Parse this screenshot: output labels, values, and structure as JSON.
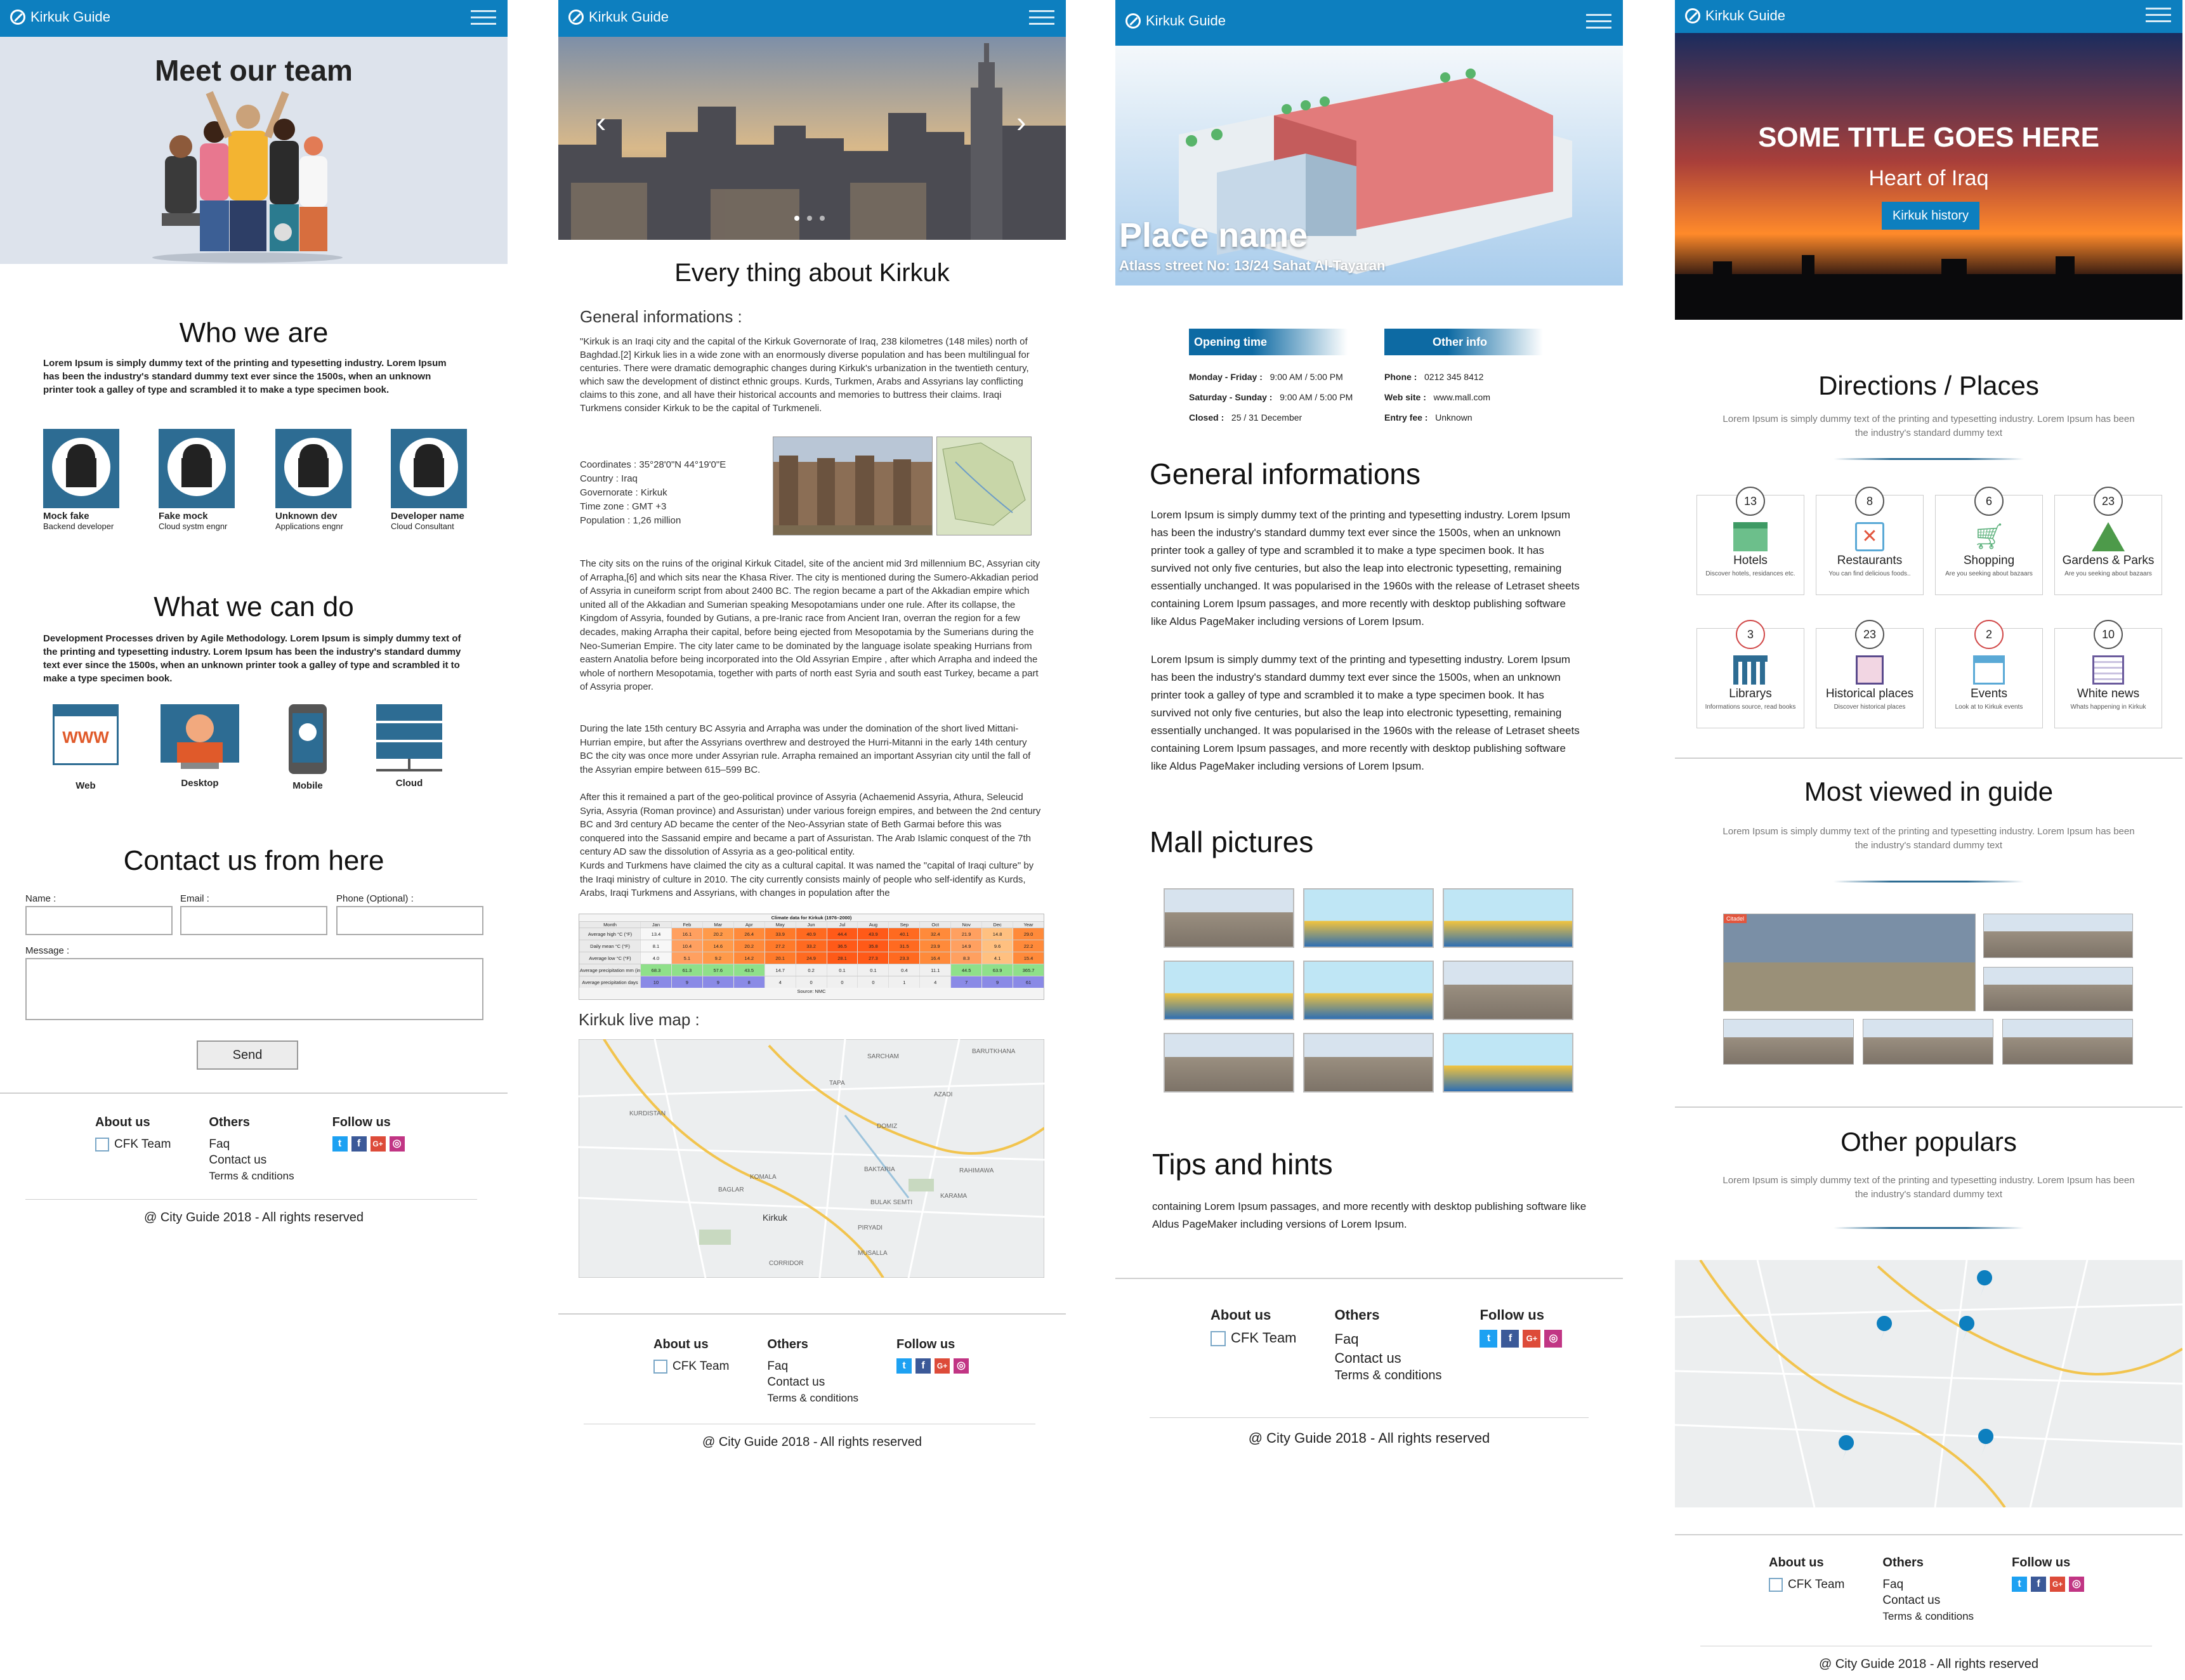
{
  "brand": "Kirkuk Guide",
  "colors": {
    "accent": "#0d7fbf",
    "dark_blue": "#2d6c93",
    "light_gray": "#dde3ec"
  },
  "s1": {
    "hero_title": "Meet our team",
    "who_title": "Who we are",
    "who_text": "Lorem Ipsum is simply dummy text of the printing and typesetting industry. Lorem Ipsum has been the industry's standard dummy text ever since the 1500s, when an unknown printer took a galley of type and scrambled it to make a type specimen book.",
    "team": [
      {
        "name": "Mock fake",
        "role": "Backend developer"
      },
      {
        "name": "Fake mock",
        "role": "Cloud systm engnr"
      },
      {
        "name": "Unknown dev",
        "role": "Applications engnr"
      },
      {
        "name": "Developer name",
        "role": "Cloud Consultant"
      }
    ],
    "what_title": "What we can do",
    "what_text": "Development Processes driven by Agile Methodology. Lorem Ipsum is simply dummy text of the printing and typesetting industry. Lorem Ipsum has been the industry's standard dummy text ever since the 1500s, when an unknown printer took a galley of type and scrambled it to make a type specimen book.",
    "services": [
      {
        "label": "Web",
        "icon": "web-icon"
      },
      {
        "label": "Desktop",
        "icon": "desktop-icon"
      },
      {
        "label": "Mobile",
        "icon": "mobile-icon"
      },
      {
        "label": "Cloud",
        "icon": "cloud-icon"
      }
    ],
    "contact_title": "Contact us from here",
    "name_label": "Name :",
    "email_label": "Email :",
    "phone_label": "Phone (Optional) :",
    "message_label": "Message :",
    "send_label": "Send"
  },
  "footer": {
    "about": "About us",
    "team": "CFK Team",
    "others": "Others",
    "faq": "Faq",
    "contact": "Contact us",
    "terms": "Terms & cnditions",
    "terms_alt": "Terms & conditions",
    "follow": "Follow us",
    "copyright": "@ City Guide 2018 - All rights reserved"
  },
  "s2": {
    "title": "Every thing about Kirkuk",
    "general_title": "General informations :",
    "p1": "\"Kirkuk is an Iraqi city and the capital of the Kirkuk Governorate of Iraq, 238 kilometres (148 miles) north of Baghdad.[2] Kirkuk lies in a wide zone with an enormously diverse population and has been multilingual for centuries. There were dramatic demographic changes during Kirkuk's urbanization in the twentieth century, which saw the development of distinct ethnic groups. Kurds, Turkmen, Arabs and Assyrians lay conflicting claims to this zone, and all have their historical accounts and memories to buttress their claims. Iraqi Turkmens consider Kirkuk to be the capital of Turkmeneli.",
    "facts": [
      {
        "k": "Coordinates",
        "v": "35°28'0\"N 44°19'0\"E"
      },
      {
        "k": "Country",
        "v": "Iraq"
      },
      {
        "k": "Governorate",
        "v": "Kirkuk"
      },
      {
        "k": "Time zone",
        "v": "GMT +3"
      },
      {
        "k": "Population",
        "v": "1,26 million"
      }
    ],
    "p2": "The city sits on the ruins of the original Kirkuk Citadel, site of the ancient mid 3rd millennium BC, Assyrian city of Arrapha,[6] and which sits near the Khasa River. The city is mentioned during the Sumero-Akkadian period of Assyria in cuneiform script from about 2400 BC. The region became a part of the Akkadian empire which united all of the Akkadian and Sumerian speaking Mesopotamians under one rule. After its collapse, the Kingdom of Assyria, founded by Gutians, a pre-Iranic race from Ancient Iran, overran the region for a few decades, making Arrapha their capital, before being ejected from Mesopotamia by the Sumerians during the Neo-Sumerian Empire. The city later came to be dominated by the language isolate speaking Hurrians from eastern Anatolia before being incorporated into the Old Assyrian Empire , after which Arrapha and indeed the whole of northern Mesopotamia, together with parts of north east Syria and south east Turkey, became a part of Assyria proper.",
    "p3": "During the late 15th century BC Assyria and Arrapha was under the domination of the short lived Mittani-Hurrian empire, but after the Assyrians overthrew and destroyed the Hurri-Mitanni in the early 14th century BC the city was once more under Assyrian rule. Arrapha remained an important Assyrian city until the fall of the Assyrian empire between 615–599 BC.",
    "p4": "After this it remained a part of the geo-political province of Assyria (Achaemenid Assyria, Athura, Seleucid Syria, Assyria (Roman province) and Assuristan) under various foreign empires, and between the 2nd century BC and 3rd century AD became the center of the Neo-Assyrian state of Beth Garmai before this was conquered into the Sassanid empire and became a part of Assuristan. The Arab Islamic conquest of the 7th century AD saw the dissolution of Assyria as a geo-political entity.\nKurds and Turkmens have claimed the city as a cultural capital. It was named the \"capital of Iraqi culture\" by the Iraqi ministry of culture in 2010. The city currently consists mainly of people who self-identify as Kurds, Arabs, Iraqi Turkmens and Assyrians, with changes in population after the",
    "climate_caption": "Climate data for Kirkuk (1976–2000)",
    "climate_headers": [
      "Month",
      "Jan",
      "Feb",
      "Mar",
      "Apr",
      "May",
      "Jun",
      "Jul",
      "Aug",
      "Sep",
      "Oct",
      "Nov",
      "Dec",
      "Year"
    ],
    "climate_rows": [
      [
        "Average high °C (°F)",
        "13.4",
        "16.1",
        "20.2",
        "26.4",
        "33.9",
        "40.9",
        "44.4",
        "43.9",
        "40.1",
        "32.4",
        "21.9",
        "14.8",
        "29.0"
      ],
      [
        "Daily mean °C (°F)",
        "8.1",
        "10.4",
        "14.6",
        "20.2",
        "27.2",
        "33.2",
        "36.5",
        "35.8",
        "31.5",
        "23.9",
        "14.9",
        "9.6",
        "22.2"
      ],
      [
        "Average low °C (°F)",
        "4.0",
        "5.1",
        "9.2",
        "14.2",
        "20.1",
        "24.9",
        "28.1",
        "27.3",
        "23.3",
        "16.4",
        "8.3",
        "4.1",
        "15.4"
      ],
      [
        "Average precipitation mm (inches)",
        "68.3",
        "61.3",
        "57.6",
        "43.5",
        "14.7",
        "0.2",
        "0.1",
        "0.1",
        "0.4",
        "11.1",
        "44.5",
        "63.9",
        "365.7"
      ],
      [
        "Average precipitation days",
        "10",
        "9",
        "9",
        "8",
        "4",
        "0",
        "0",
        "0",
        "1",
        "4",
        "7",
        "9",
        "61"
      ]
    ],
    "climate_source": "Source: NMC",
    "map_title": "Kirkuk live map :",
    "map_labels": [
      "SARCHAM",
      "BARUTKHANA",
      "TAPA",
      "AZADI",
      "AL-KARAMA",
      "KURDISTAN",
      "DOMIZ",
      "KOMALA",
      "RAHIMAWA",
      "BAGLAR",
      "BAKTARIA",
      "BULAK SEMTI",
      "KARAMA",
      "PIRYADI",
      "Kirkuk",
      "MUSALLA",
      "CORRIDOR",
      "KAWAS",
      "SHORJA"
    ]
  },
  "s3": {
    "place_name": "Place name",
    "address": "Atlass street No: 13/24 Sahat Al-Tayaran",
    "opening_title": "Opening time",
    "opening": [
      {
        "k": "Monday - Friday :",
        "v": "9:00 AM / 5:00 PM"
      },
      {
        "k": "Saturday - Sunday :",
        "v": "9:00 AM / 5:00 PM"
      },
      {
        "k": "Closed :",
        "v": "25 / 31 December"
      }
    ],
    "other_title": "Other info",
    "other": [
      {
        "k": "Phone :",
        "v": "0212 345 8412"
      },
      {
        "k": "Web site :",
        "v": "www.mall.com"
      },
      {
        "k": "Entry fee :",
        "v": "Unknown"
      }
    ],
    "general_title": "General informations",
    "gp1": "Lorem Ipsum is simply dummy text of the printing and typesetting industry. Lorem Ipsum has been the industry's standard dummy text ever since the 1500s, when an unknown printer took a galley of type and scrambled it to make a type specimen book. It has survived not only five centuries, but also the leap into electronic typesetting, remaining essentially unchanged. It was popularised in the 1960s with the release of Letraset sheets containing Lorem Ipsum passages, and more recently with desktop publishing software like Aldus PageMaker including versions of Lorem Ipsum.",
    "gp2": "Lorem Ipsum is simply dummy text of the printing and typesetting industry. Lorem Ipsum has been the industry's standard dummy text ever since the 1500s, when an unknown printer took a galley of type and scrambled it to make a type specimen book. It has survived not only five centuries, but also the leap into electronic typesetting, remaining essentially unchanged. It was popularised in the 1960s with the release of Letraset sheets containing Lorem Ipsum passages, and more recently with desktop publishing software like Aldus PageMaker including versions of Lorem Ipsum.",
    "pictures_title": "Mall pictures",
    "tips_title": "Tips and hints",
    "tips_text": "containing Lorem Ipsum passages, and more recently with desktop publishing software like Aldus PageMaker including versions of Lorem Ipsum."
  },
  "s4": {
    "hero_title": "SOME TITLE GOES HERE",
    "hero_sub": "Heart of Iraq",
    "hero_btn": "Kirkuk history",
    "dir_title": "Directions / Places",
    "dir_text": "Lorem Ipsum is simply dummy text of the printing and typesetting industry. Lorem Ipsum has been the industry's standard dummy text",
    "categories": [
      {
        "count": "13",
        "label": "Hotels",
        "desc": "Discover hotels, residances etc.",
        "icon": "hotel-icon"
      },
      {
        "count": "8",
        "label": "Restaurants",
        "desc": "You can find delicious foods..",
        "icon": "restaurant-icon"
      },
      {
        "count": "6",
        "label": "Shopping",
        "desc": "Are you seeking about bazaars",
        "icon": "cart-icon"
      },
      {
        "count": "23",
        "label": "Gardens & Parks",
        "desc": "Are you seeking about bazaars",
        "icon": "park-icon"
      },
      {
        "count": "3",
        "label": "Librarys",
        "desc": "Informations source, read books",
        "icon": "library-icon"
      },
      {
        "count": "23",
        "label": "Historical places",
        "desc": "Discover historical places",
        "icon": "history-icon"
      },
      {
        "count": "2",
        "label": "Events",
        "desc": "Look at to Kirkuk events",
        "icon": "calendar-icon"
      },
      {
        "count": "10",
        "label": "White news",
        "desc": "Whats happening in Kirkuk",
        "icon": "news-icon"
      }
    ],
    "most_title": "Most viewed in guide",
    "most_text": "Lorem Ipsum is simply dummy text of the printing and typesetting industry. Lorem Ipsum has been the industry's standard dummy text",
    "other_title": "Other populars",
    "other_text": "Lorem Ipsum is simply dummy text of the printing and typesetting industry. Lorem Ipsum has been the industry's standard dummy text",
    "badge": "Citadel"
  }
}
